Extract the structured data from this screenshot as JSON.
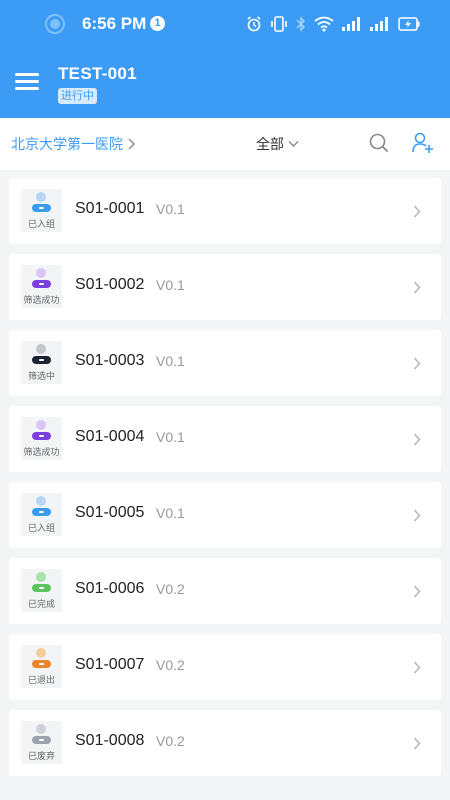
{
  "status_bar": {
    "time": "6:56 PM",
    "notification_count": "1",
    "icons": [
      "alarm-icon",
      "vibrate-icon",
      "bluetooth-icon",
      "wifi-icon",
      "signal-icon",
      "signal-icon",
      "battery-icon"
    ]
  },
  "header": {
    "title": "TEST-001",
    "status": "进行中",
    "menu_icon": "hamburger-menu-icon",
    "background_color": "#3c9cf5"
  },
  "filter_bar": {
    "site": "北京大学第一医院",
    "filter": "全部",
    "search_icon": "search-icon",
    "add_icon": "add-user-icon"
  },
  "subjects": [
    {
      "id": "S01-0001",
      "version": "V0.1",
      "status": "已入组",
      "color": "#3a9bf0",
      "head_color": "#b6d7f7"
    },
    {
      "id": "S01-0002",
      "version": "V0.1",
      "status": "筛选成功",
      "color": "#7b3fe0",
      "head_color": "#d9c4f5"
    },
    {
      "id": "S01-0003",
      "version": "V0.1",
      "status": "筛选中",
      "color": "#1d2236",
      "head_color": "#c3c5cc"
    },
    {
      "id": "S01-0004",
      "version": "V0.1",
      "status": "筛选成功",
      "color": "#7b3fe0",
      "head_color": "#d9c4f5"
    },
    {
      "id": "S01-0005",
      "version": "V0.1",
      "status": "已入组",
      "color": "#3a9bf0",
      "head_color": "#b6d7f7"
    },
    {
      "id": "S01-0006",
      "version": "V0.2",
      "status": "已完成",
      "color": "#5cc45e",
      "head_color": "#a9e3a8"
    },
    {
      "id": "S01-0007",
      "version": "V0.2",
      "status": "已退出",
      "color": "#e8862b",
      "head_color": "#f6cc9f"
    },
    {
      "id": "S01-0008",
      "version": "V0.2",
      "status": "已废弃",
      "color": "#9aa3ae",
      "head_color": "#cdd2d8"
    }
  ]
}
